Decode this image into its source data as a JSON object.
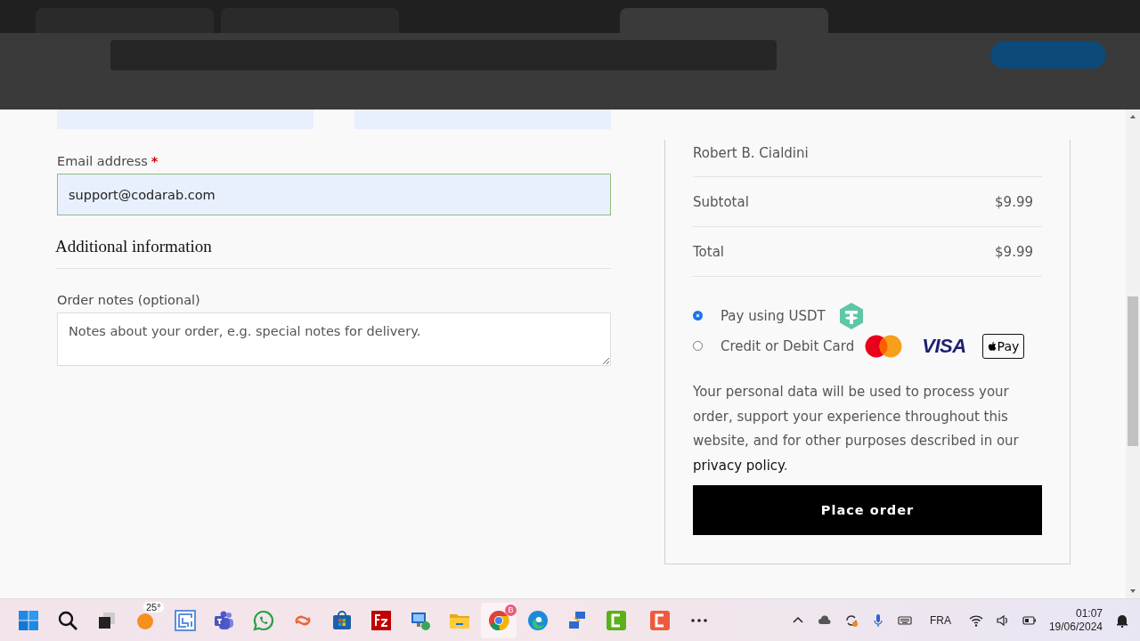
{
  "browser_tabs": [
    {
      "selected": false
    },
    {
      "selected": false
    },
    {
      "selected": true
    }
  ],
  "form": {
    "email_label": "Email address",
    "required_mark": "*",
    "email_value": "support@codarab.com",
    "section_title": "Additional information",
    "notes_label": "Order notes (optional)",
    "notes_placeholder": "Notes about your order, e.g. special notes for delivery."
  },
  "order": {
    "item_author": "Robert B. Cialdini",
    "rows": [
      {
        "label": "Subtotal",
        "value": "$9.99"
      },
      {
        "label": "Total",
        "value": "$9.99"
      }
    ],
    "payment_methods": [
      {
        "kind": "usdt",
        "label": "Pay using USDT",
        "selected": true
      },
      {
        "kind": "cards",
        "label": "Credit or Debit Card",
        "selected": false,
        "visa_text": "VISA",
        "applepay_text": "Pay"
      }
    ],
    "privacy_text": "Your personal data will be used to process your order, support your experience throughout this website, and for other purposes described in our",
    "privacy_link": "privacy policy",
    "privacy_end": ".",
    "button": "Place order"
  },
  "taskbar": {
    "weather_temp": "25°",
    "browser_badge": "B",
    "language": "FRA",
    "time": "01:07",
    "date": "19/06/2024"
  }
}
